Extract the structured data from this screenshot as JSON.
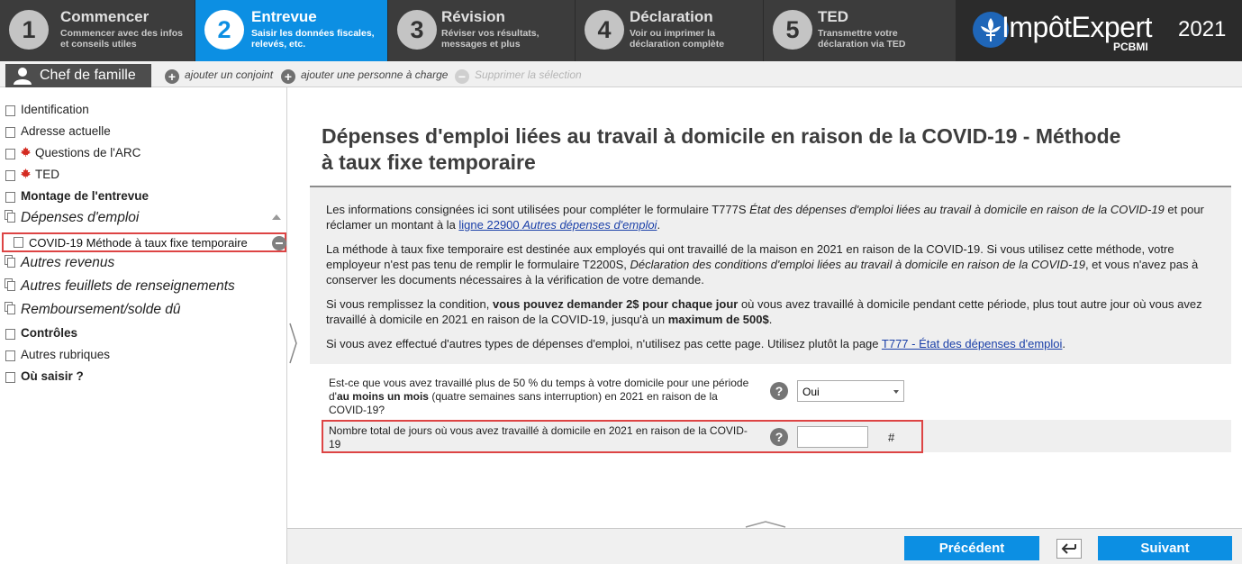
{
  "steps": [
    {
      "num": "1",
      "title": "Commencer",
      "desc1": "Commencer avec des infos",
      "desc2": "et conseils utiles"
    },
    {
      "num": "2",
      "title": "Entrevue",
      "desc1": "Saisir les données fiscales,",
      "desc2": "relevés, etc."
    },
    {
      "num": "3",
      "title": "Révision",
      "desc1": "Réviser vos résultats,",
      "desc2": "messages et plus"
    },
    {
      "num": "4",
      "title": "Déclaration",
      "desc1": "Voir ou imprimer la",
      "desc2": "déclaration complète"
    },
    {
      "num": "5",
      "title": "TED",
      "desc1": "Transmettre votre",
      "desc2": "déclaration via TED"
    }
  ],
  "logo": {
    "brand": "ImpôtExpert",
    "sub": "PCBMI",
    "year": "2021"
  },
  "family": {
    "person": "Chef de famille",
    "add_spouse": "ajouter un conjoint",
    "add_dependent": "ajouter une personne à charge",
    "delete_selection": "Supprimer la sélection"
  },
  "sidebar": {
    "identification": "Identification",
    "address": "Adresse actuelle",
    "cra_questions": "Questions de l'ARC",
    "ted": "TED",
    "interview_setup": "Montage de l'entrevue",
    "employment_expenses": "Dépenses d'emploi",
    "covid_item": "COVID-19 Méthode à taux fixe temporaire",
    "other_income": "Autres revenus",
    "other_slips": "Autres feuillets de renseignements",
    "refund_balance": "Remboursement/solde dû",
    "controls": "Contrôles",
    "other_sections": "Autres rubriques",
    "where_enter": "Où saisir ?"
  },
  "page": {
    "title_line1": "Dépenses d'emploi liées au travail à domicile en raison de la COVID-19 - Méthode",
    "title_line2": "à taux fixe temporaire"
  },
  "info": {
    "p1_a": "Les informations consignées ici sont utilisées pour compléter le formulaire T777S ",
    "p1_b": "État des dépenses d'emploi liées au travail à domicile en raison de la COVID-19",
    "p1_c": " et pour réclamer un montant à la ",
    "p1_link1": "ligne 22900",
    "p1_link2": "Autres dépenses d'emploi",
    "p1_d": ".",
    "p2_a": "La méthode à taux fixe temporaire est destinée aux employés qui ont travaillé de la maison en 2021 en raison de la COVID-19. Si vous utilisez cette méthode, votre employeur n'est pas tenu de remplir le formulaire T2200S, ",
    "p2_b": "Déclaration des conditions d'emploi liées au travail à domicile en raison de la COVID-19",
    "p2_c": ", et vous n'avez pas à conserver les documents nécessaires à la vérification de votre demande.",
    "p3_a": "Si vous remplissez la condition, ",
    "p3_b": "vous pouvez demander 2$ pour chaque jour",
    "p3_c": " où vous avez travaillé à domicile pendant cette période, plus tout autre jour où vous avez travaillé à domicile en 2021 en raison de la COVID-19, jusqu'à un ",
    "p3_d": "maximum de 500$",
    "p3_e": ".",
    "p4_a": "Si vous avez effectué d'autres types de dépenses d'emploi, n'utilisez pas cette page. Utilisez plutôt la page ",
    "p4_link": "T777 - État des dépenses d'emploi",
    "p4_b": "."
  },
  "questions": {
    "q1_a": "Est-ce que vous avez travaillé plus de 50 % du temps à votre domicile pour une période d'",
    "q1_b": "au moins un mois",
    "q1_c": " (quatre semaines sans interruption) en 2021 en raison de la COVID-19?",
    "q1_value": "Oui",
    "q2": "Nombre total de jours où vous avez travaillé à domicile en 2021 en raison de la COVID-19",
    "q2_value": "",
    "q2_unit": "#",
    "help": "?"
  },
  "buttons": {
    "previous": "Précédent",
    "next": "Suivant"
  }
}
